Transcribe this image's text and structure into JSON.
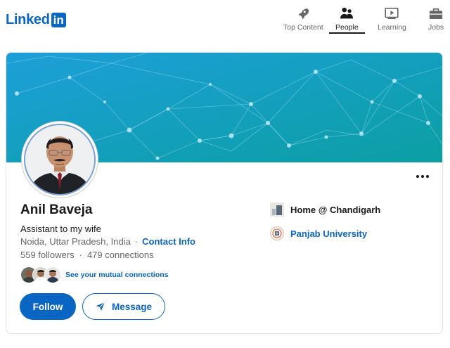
{
  "brand": {
    "logo_word": "Linked",
    "logo_box": "in"
  },
  "nav": {
    "items": [
      {
        "label": "Top Content",
        "icon": "rocket-icon"
      },
      {
        "label": "People",
        "icon": "people-icon",
        "active": true
      },
      {
        "label": "Learning",
        "icon": "play-icon"
      },
      {
        "label": "Jobs",
        "icon": "briefcase-icon"
      }
    ]
  },
  "profile": {
    "name": "Anil Baveja",
    "headline": "Assistant to my wife",
    "location": "Noida, Uttar Pradesh, India",
    "location_separator": "·",
    "contact_info": "Contact Info",
    "followers": "559 followers",
    "stats_separator": "·",
    "connections": "479 connections",
    "mutual_text": "See your mutual connections",
    "follow_label": "Follow",
    "message_label": "Message"
  },
  "side": {
    "current": "Home @ Chandigarh",
    "education": "Panjab University"
  },
  "colors": {
    "brand_blue": "#0a66c2",
    "banner_start": "#1a9bd8",
    "banner_end": "#0aa0a8"
  }
}
